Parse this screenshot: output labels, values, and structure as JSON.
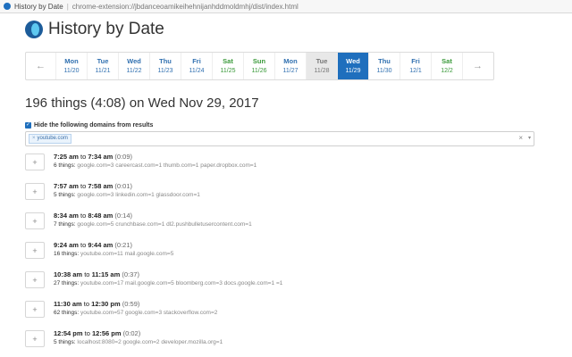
{
  "browser": {
    "tab_title": "History by Date",
    "url": "chrome-extension://jbdanceoamikeihehnijanhddmoldmhj/dist/index.html"
  },
  "header": {
    "title": "History by Date"
  },
  "days": {
    "prev": "←",
    "next": "→",
    "items": [
      {
        "dow": "Mon",
        "date": "11/20"
      },
      {
        "dow": "Tue",
        "date": "11/21"
      },
      {
        "dow": "Wed",
        "date": "11/22"
      },
      {
        "dow": "Thu",
        "date": "11/23"
      },
      {
        "dow": "Fri",
        "date": "11/24"
      },
      {
        "dow": "Sat",
        "date": "11/25"
      },
      {
        "dow": "Sun",
        "date": "11/26"
      },
      {
        "dow": "Mon",
        "date": "11/27"
      },
      {
        "dow": "Tue",
        "date": "11/28"
      },
      {
        "dow": "Wed",
        "date": "11/29"
      },
      {
        "dow": "Thu",
        "date": "11/30"
      },
      {
        "dow": "Fri",
        "date": "12/1"
      },
      {
        "dow": "Sat",
        "date": "12/2"
      }
    ],
    "active_index": 9,
    "empty_index": 8
  },
  "summary": "196 things (4:08) on Wed Nov 29, 2017",
  "filter": {
    "label": "Hide the following domains from results",
    "tag": "youtube.com",
    "clear": "×",
    "dropdown": "▾"
  },
  "sessions": [
    {
      "start": "7:25 am",
      "to": "to",
      "end": "7:34 am",
      "dur": "(0:09)",
      "count": "6 things:",
      "domains": "google.com=3 careercast.com=1 thumb.com=1 paper.dropbox.com=1"
    },
    {
      "start": "7:57 am",
      "to": "to",
      "end": "7:58 am",
      "dur": "(0:01)",
      "count": "5 things:",
      "domains": "google.com=3 linkedin.com=1 glassdoor.com=1"
    },
    {
      "start": "8:34 am",
      "to": "to",
      "end": "8:48 am",
      "dur": "(0:14)",
      "count": "7 things:",
      "domains": "google.com=5 crunchbase.com=1 dl2.pushbulletusercontent.com=1"
    },
    {
      "start": "9:24 am",
      "to": "to",
      "end": "9:44 am",
      "dur": "(0:21)",
      "count": "16 things:",
      "domains": "youtube.com=11 mail.google.com=5"
    },
    {
      "start": "10:38 am",
      "to": "to",
      "end": "11:15 am",
      "dur": "(0:37)",
      "count": "27 things:",
      "domains": "youtube.com=17 mail.google.com=5 bloomberg.com=3 docs.google.com=1 =1"
    },
    {
      "start": "11:30 am",
      "to": "to",
      "end": "12:30 pm",
      "dur": "(0:59)",
      "count": "62 things:",
      "domains": "youtube.com=57 google.com=3 stackoverflow.com=2"
    },
    {
      "start": "12:54 pm",
      "to": "to",
      "end": "12:56 pm",
      "dur": "(0:02)",
      "count": "5 things:",
      "domains": "localhost:8080=2 google.com=2 developer.mozilla.org=1"
    }
  ],
  "expand_symbol": "+"
}
